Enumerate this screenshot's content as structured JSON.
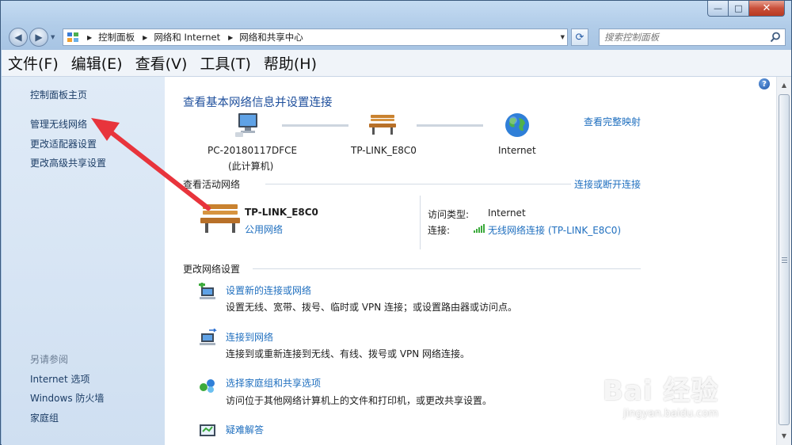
{
  "window": {
    "minimize_glyph": "—",
    "maximize_glyph": "□",
    "close_glyph": "✕"
  },
  "address_bar": {
    "breadcrumbs": [
      "控制面板",
      "网络和 Internet",
      "网络和共享中心"
    ],
    "search_placeholder": "搜索控制面板"
  },
  "menu": [
    "文件(F)",
    "编辑(E)",
    "查看(V)",
    "工具(T)",
    "帮助(H)"
  ],
  "sidebar": {
    "home": "控制面板主页",
    "links": [
      "管理无线网络",
      "更改适配器设置",
      "更改高级共享设置"
    ],
    "see_also_heading": "另请参阅",
    "see_also": [
      "Internet 选项",
      "Windows 防火墙",
      "家庭组"
    ]
  },
  "main": {
    "title": "查看基本网络信息并设置连接",
    "view_full_map": "查看完整映射",
    "map": {
      "computer_name": "PC-20180117DFCE",
      "computer_sub": "(此计算机)",
      "router_name": "TP-LINK_E8C0",
      "internet_name": "Internet"
    },
    "active": {
      "heading": "查看活动网络",
      "connect_link": "连接或断开连接",
      "network_name": "TP-LINK_E8C0",
      "network_type": "公用网络",
      "access_label": "访问类型:",
      "access_value": "Internet",
      "conn_label": "连接:",
      "conn_value": "无线网络连接 (TP-LINK_E8C0)"
    },
    "change": {
      "heading": "更改网络设置",
      "items": [
        {
          "title": "设置新的连接或网络",
          "desc": "设置无线、宽带、拨号、临时或 VPN 连接；或设置路由器或访问点。"
        },
        {
          "title": "连接到网络",
          "desc": "连接到或重新连接到无线、有线、拨号或 VPN 网络连接。"
        },
        {
          "title": "选择家庭组和共享选项",
          "desc": "访问位于其他网络计算机上的文件和打印机，或更改共享设置。"
        },
        {
          "title": "疑难解答",
          "desc": ""
        }
      ]
    }
  },
  "watermark": {
    "main": "Bai 经验",
    "sub": "jingyan.baidu.com"
  },
  "colors": {
    "link": "#1f6fbf",
    "title": "#1e4f9c",
    "arrow": "#e8343c"
  }
}
